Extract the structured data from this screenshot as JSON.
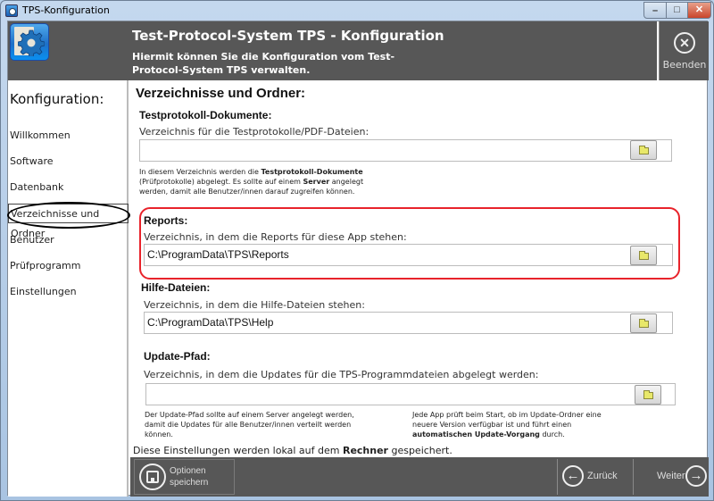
{
  "window": {
    "title": "TPS-Konfiguration",
    "controls": {
      "minimize": "–",
      "maximize": "□",
      "close": "✕"
    }
  },
  "header": {
    "title": "Test-Protocol-System TPS - Konfiguration",
    "subtitle": "Hiermit können Sie die Konfiguration vom Test-Protocol-System TPS verwalten.",
    "logo_icon": "gear-icon",
    "exit": {
      "label": "Beenden",
      "icon": "close-circle-icon",
      "glyph": "✕"
    }
  },
  "sidebar": {
    "title": "Konfiguration:",
    "items": [
      {
        "label": "Willkommen",
        "active": false
      },
      {
        "label": "Software",
        "active": false
      },
      {
        "label": "Datenbank",
        "active": false
      },
      {
        "label": "Verzeichnisse und Ordner",
        "active": true
      },
      {
        "label": "Benutzer",
        "active": false
      },
      {
        "label": "Prüfprogramm",
        "active": false
      },
      {
        "label": "Einstellungen",
        "active": false
      }
    ]
  },
  "main": {
    "title": "Verzeichnisse und Ordner:",
    "groups": {
      "documents": {
        "title": "Testprotokoll-Dokumente:",
        "label": "Verzeichnis für die Testprotokolle/PDF-Dateien:",
        "value": "",
        "note_parts": [
          "In diesem Verzeichnis werden die ",
          "Testprotokoll-Dokumente",
          " (Prüfprotokolle) abgelegt. Es sollte auf einem ",
          "Server",
          " angelegt werden, damit alle Benutzer/innen darauf zugreifen können."
        ]
      },
      "reports": {
        "title": "Reports:",
        "label": "Verzeichnis, in dem die Reports für diese App stehen:",
        "value": "C:\\ProgramData\\TPS\\Reports",
        "highlighted": true
      },
      "help": {
        "title": "Hilfe-Dateien:",
        "label": "Verzeichnis, in dem die Hilfe-Dateien stehen:",
        "value": "C:\\ProgramData\\TPS\\Help"
      },
      "update": {
        "title": "Update-Pfad:",
        "label": "Verzeichnis, in dem die Updates für die TPS-Programmdateien abgelegt werden:",
        "value": "",
        "note_left": "Der Update-Pfad sollte auf einem Server angelegt werden, damit die Updates für alle Benutzer/innen verteilt werden können.",
        "note_right_parts": [
          "Jede App prüft beim Start, ob im Update-Ordner eine neuere Version verfügbar ist und führt einen ",
          "automatischen Update-Vorgang",
          " durch."
        ]
      }
    },
    "browse_icon": "folder-icon"
  },
  "footer": {
    "note_parts": [
      "Diese Einstellungen werden lokal auf dem ",
      "Rechner",
      " gespeichert."
    ],
    "save": {
      "label_line1": "Optionen",
      "label_line2": "speichern",
      "icon": "save-icon"
    },
    "back": {
      "label": "Zurück",
      "glyph": "←"
    },
    "next": {
      "label": "Weiter",
      "glyph": "→"
    }
  }
}
